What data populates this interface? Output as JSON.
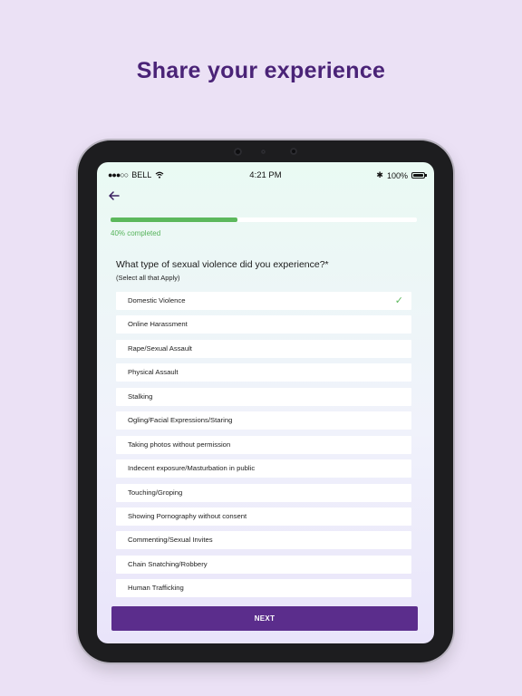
{
  "headline": "Share your experience",
  "status_bar": {
    "carrier": "BELL",
    "time": "4:21 PM",
    "battery": "100%"
  },
  "progress": {
    "fraction": 0.415,
    "label": "40% completed"
  },
  "question": {
    "title": "What type of sexual violence did you experience?*",
    "hint": "(Select all that Apply)"
  },
  "options": [
    {
      "label": "Domestic Violence",
      "selected": true
    },
    {
      "label": "Online Harassment",
      "selected": false
    },
    {
      "label": "Rape/Sexual Assault",
      "selected": false
    },
    {
      "label": "Physical Assault",
      "selected": false
    },
    {
      "label": "Stalking",
      "selected": false
    },
    {
      "label": "Ogling/Facial Expressions/Staring",
      "selected": false
    },
    {
      "label": "Taking photos without permission",
      "selected": false
    },
    {
      "label": "Indecent exposure/Masturbation in public",
      "selected": false
    },
    {
      "label": "Touching/Groping",
      "selected": false
    },
    {
      "label": "Showing Pornography without consent",
      "selected": false
    },
    {
      "label": "Commenting/Sexual Invites",
      "selected": false
    },
    {
      "label": "Chain Snatching/Robbery",
      "selected": false
    },
    {
      "label": "Human Trafficking",
      "selected": false
    }
  ],
  "next_label": "NEXT",
  "colors": {
    "background": "#ebe1f5",
    "headline": "#4a2377",
    "accent_green": "#5cb85c",
    "primary_button": "#5b2d8c"
  }
}
